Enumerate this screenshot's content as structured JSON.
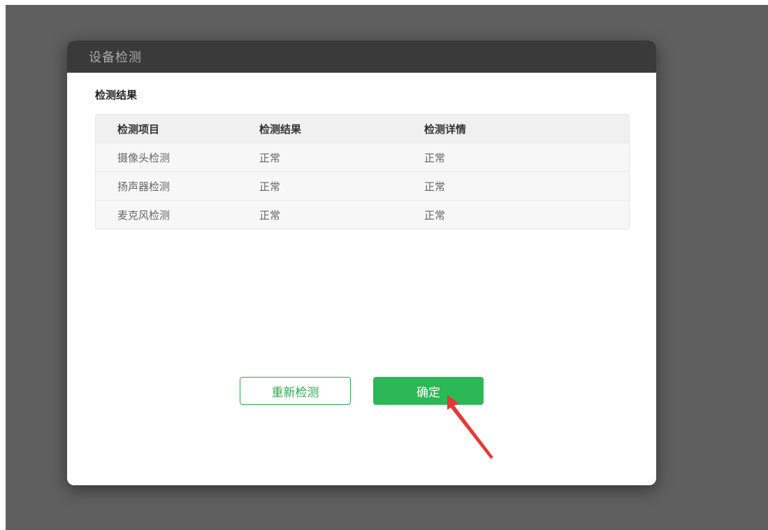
{
  "dialog": {
    "title": "设备检测",
    "section_title": "检测结果"
  },
  "table": {
    "headers": [
      "检测项目",
      "检测结果",
      "检测详情"
    ],
    "rows": [
      [
        "摄像头检测",
        "正常",
        "正常"
      ],
      [
        "扬声器检测",
        "正常",
        "正常"
      ],
      [
        "麦克风检测",
        "正常",
        "正常"
      ]
    ]
  },
  "buttons": {
    "retest": "重新检测",
    "confirm": "确定"
  },
  "colors": {
    "accent_green": "#2db857",
    "annotation_arrow": "#e53935"
  },
  "icons": {
    "annotation": "red-arrow-icon"
  }
}
